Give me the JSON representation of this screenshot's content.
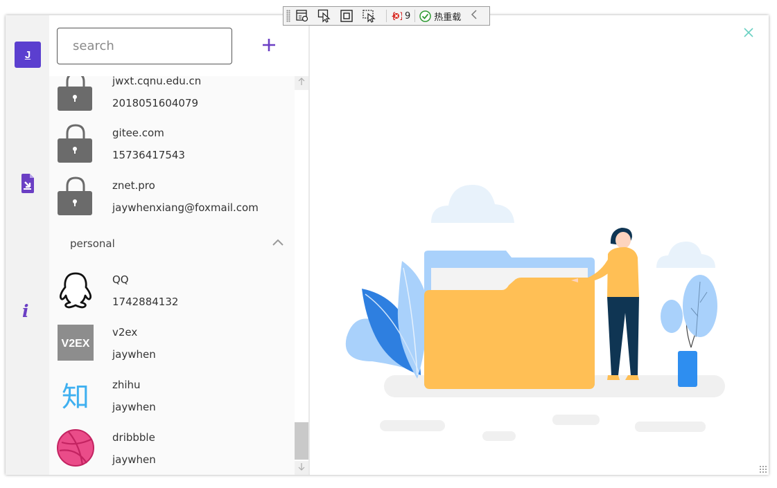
{
  "devbar": {
    "error_count": "9",
    "hot_reload_label": "热重载"
  },
  "rail": {
    "avatar_letter": "J",
    "info_glyph": "i"
  },
  "search": {
    "placeholder": "search",
    "value": ""
  },
  "list": {
    "entries": [
      {
        "site": "jwxt.cqnu.edu.cn",
        "account": "2018051604079",
        "icon": "lock-icon"
      },
      {
        "site": "gitee.com",
        "account": "15736417543",
        "icon": "lock-icon"
      },
      {
        "site": "znet.pro",
        "account": "jaywhenxiang@foxmail.com",
        "icon": "lock-icon"
      }
    ],
    "group": {
      "name": "personal",
      "entries": [
        {
          "site": "QQ",
          "account": "1742884132",
          "icon": "qq-icon"
        },
        {
          "site": "v2ex",
          "account": "jaywhen",
          "icon": "v2ex-icon",
          "logo_text": "V2EX"
        },
        {
          "site": "zhihu",
          "account": "jaywhen",
          "icon": "zhihu-icon",
          "logo_text": "知"
        },
        {
          "site": "dribbble",
          "account": "jaywhen",
          "icon": "dribbble-icon"
        }
      ]
    }
  },
  "colors": {
    "accent": "#5b3fcf",
    "add_button": "#6b3fc4",
    "close_button": "#6ad0c2",
    "folder": "#ffbf55",
    "lock": "#6b6b6b"
  }
}
